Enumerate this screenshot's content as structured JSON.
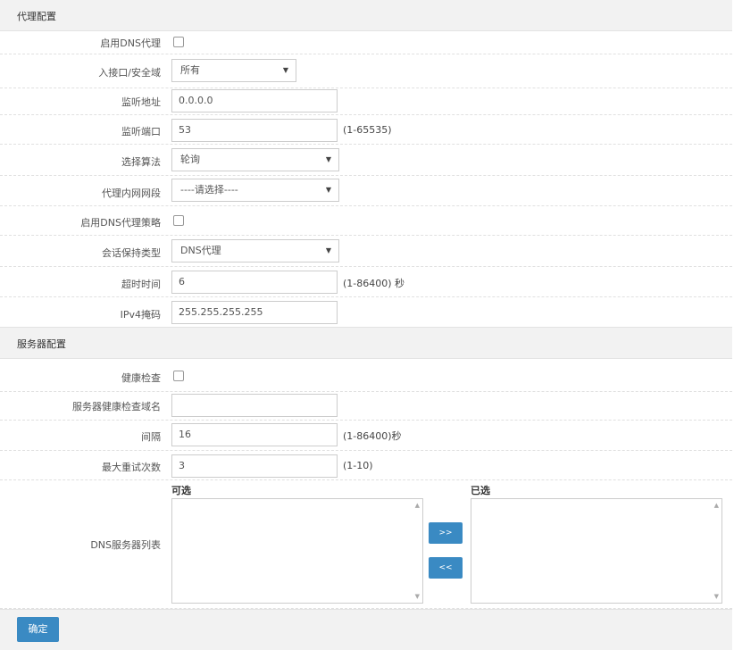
{
  "proxy_section": {
    "title": "代理配置",
    "enable_dns_proxy_label": "启用DNS代理",
    "ingress_label": "入接口/安全域",
    "ingress_value": "所有",
    "listen_addr_label": "监听地址",
    "listen_addr_value": "0.0.0.0",
    "listen_port_label": "监听端口",
    "listen_port_value": "53",
    "listen_port_hint": "(1-65535)",
    "algorithm_label": "选择算法",
    "algorithm_value": "轮询",
    "proxy_intranet_label": "代理内网网段",
    "proxy_intranet_value": "----请选择----",
    "enable_policy_label": "启用DNS代理策略",
    "session_type_label": "会话保持类型",
    "session_type_value": "DNS代理",
    "timeout_label": "超时时间",
    "timeout_value": "6",
    "timeout_hint": "(1-86400) 秒",
    "ipv4_mask_label": "IPv4掩码",
    "ipv4_mask_value": "255.255.255.255"
  },
  "server_section": {
    "title": "服务器配置",
    "health_check_label": "健康检查",
    "health_domain_label": "服务器健康检查域名",
    "health_domain_value": "",
    "interval_label": "间隔",
    "interval_value": "16",
    "interval_hint": "(1-86400)秒",
    "max_retry_label": "最大重试次数",
    "max_retry_value": "3",
    "max_retry_hint": "(1-10)",
    "dns_list_label": "DNS服务器列表",
    "available_title": "可选",
    "selected_title": "已选",
    "add_button": ">>",
    "remove_button": "<<"
  },
  "confirm_button": "确定",
  "icons": {
    "dropdown": "triangle-down",
    "scroll_up": "triangle-up",
    "scroll_down": "triangle-down"
  }
}
